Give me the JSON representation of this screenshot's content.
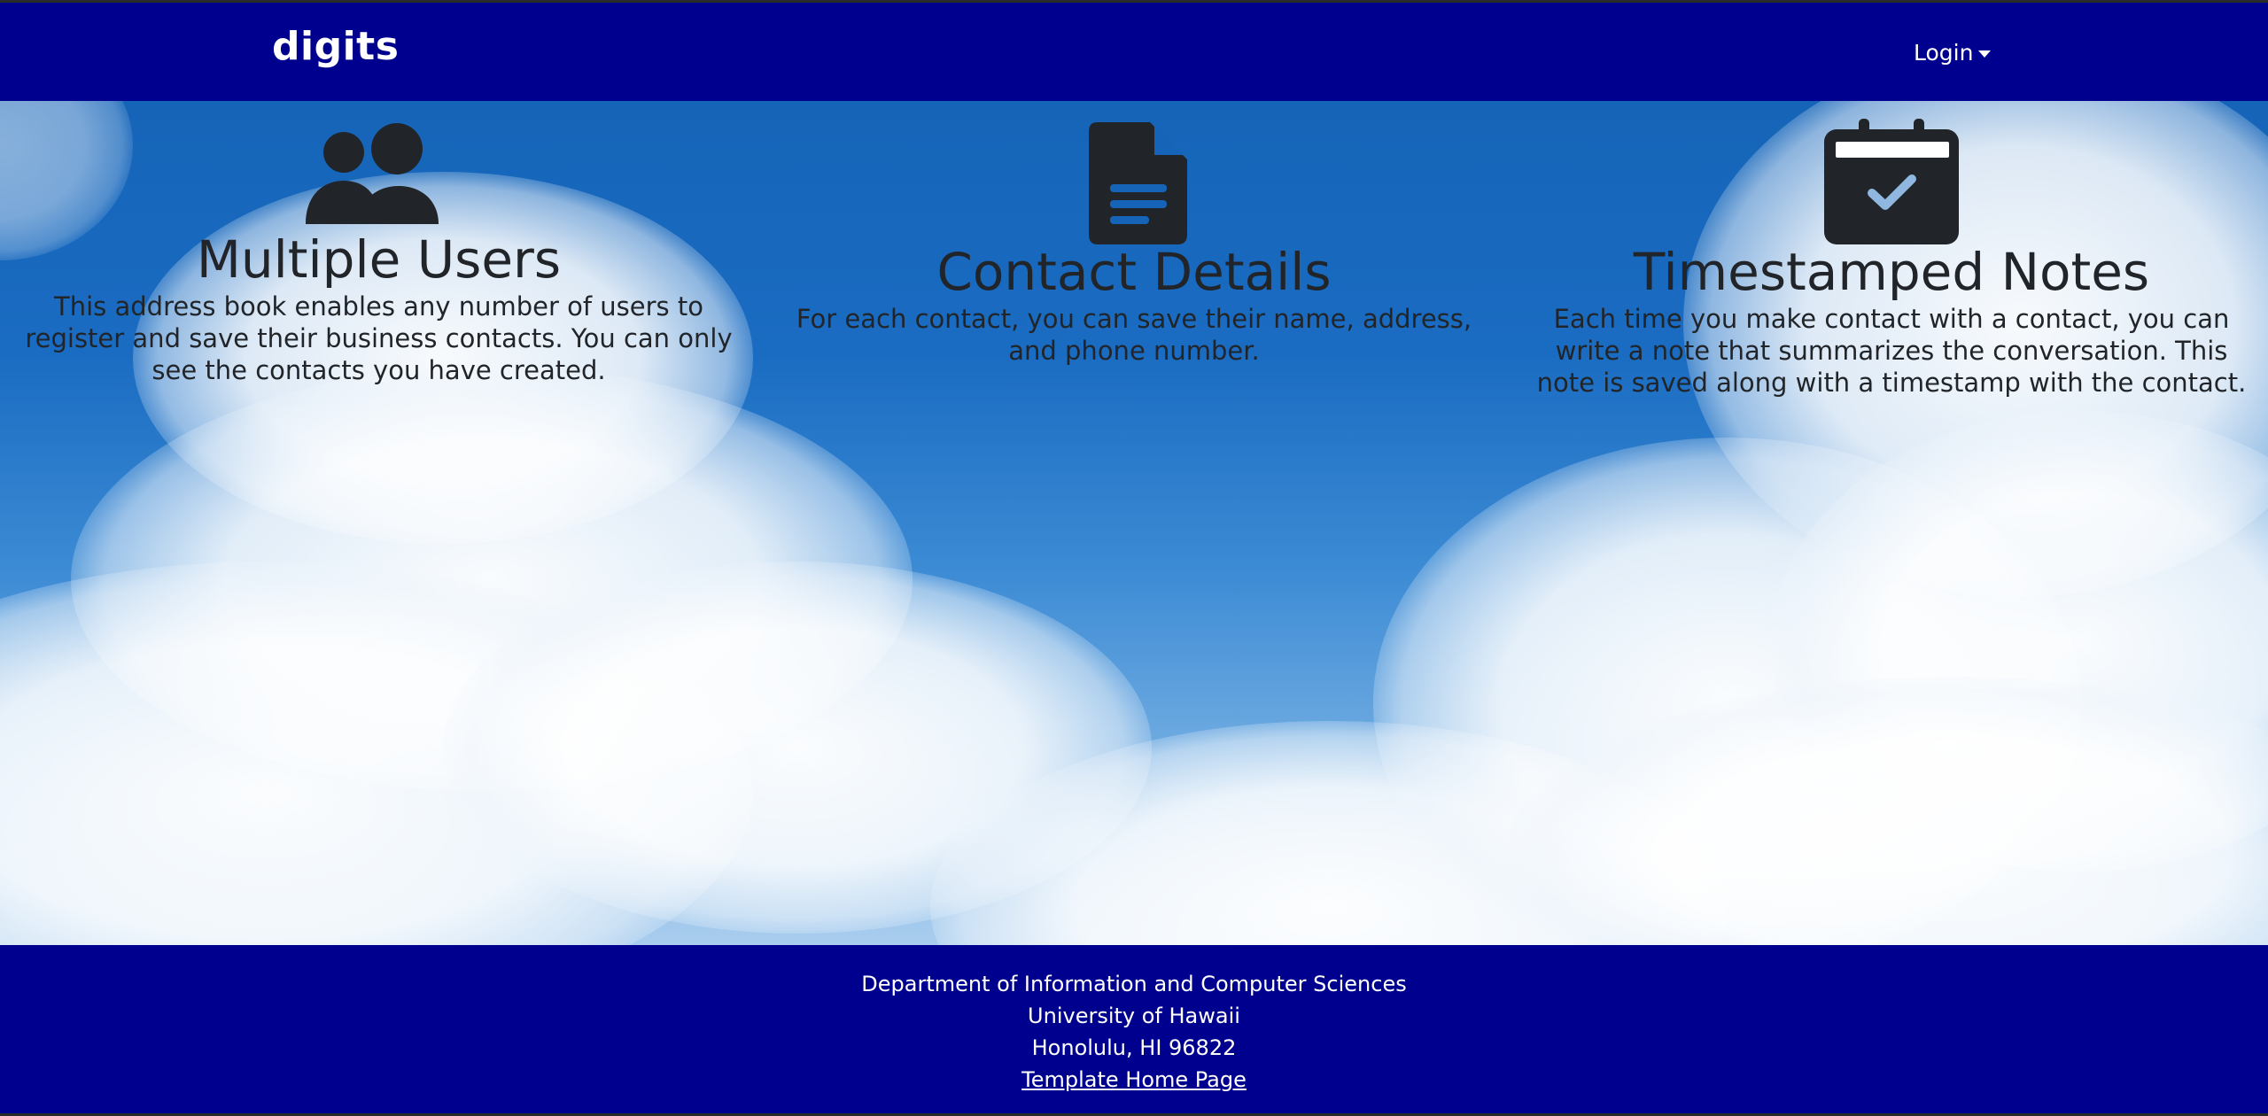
{
  "navbar": {
    "brand": "digits",
    "login_label": "Login"
  },
  "features": [
    {
      "icon": "users-icon",
      "title": "Multiple Users",
      "text": "This address book enables any number of users to register and save their business contacts. You can only see the contacts you have created."
    },
    {
      "icon": "file-text-icon",
      "title": "Contact Details",
      "text": "For each contact, you can save their name, address, and phone number."
    },
    {
      "icon": "calendar-check-icon",
      "title": "Timestamped Notes",
      "text": "Each time you make contact with a contact, you can write a note that summarizes the conversation. This note is saved along with a timestamp with the contact."
    }
  ],
  "footer": {
    "line1": "Department of Information and Computer Sciences",
    "line2": "University of Hawaii",
    "line3": "Honolulu, HI 96822",
    "link": "Template Home Page"
  },
  "colors": {
    "navbar": "#00008f",
    "footer": "#00008f",
    "icon": "#212529"
  }
}
